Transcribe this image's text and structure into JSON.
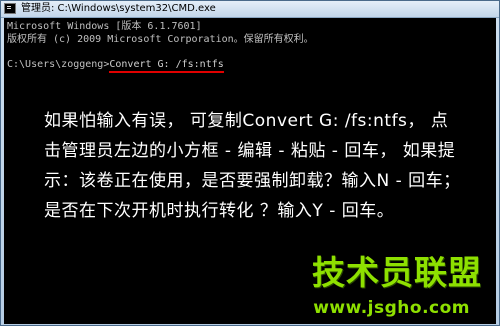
{
  "window": {
    "title": "管理员: C:\\Windows\\system32\\CMD.exe",
    "icon": "cmd-icon"
  },
  "console": {
    "line1": "Microsoft Windows [版本 6.1.7601]",
    "line2": "版权所有 (c) 2009 Microsoft Corporation。保留所有权利。",
    "prompt": "C:\\Users\\zoggeng>",
    "command": "Convert G: /fs:ntfs"
  },
  "annotation": {
    "text": "如果怕输入有误， 可复制Convert G: /fs:ntfs， 点击管理员左边的小方框 - 编辑 - 粘贴 - 回车， 如果提示：该卷正在使用，是否要强制卸载？输入N - 回车；是否在下次开机时执行转化 ？输入Y - 回车。"
  },
  "watermark": {
    "title": "技术员联盟",
    "url": "www.jsgho.com",
    "color": "#8ee000"
  },
  "colors": {
    "console_bg": "#000000",
    "console_text": "#c0c0c0",
    "underline": "#e00000"
  }
}
